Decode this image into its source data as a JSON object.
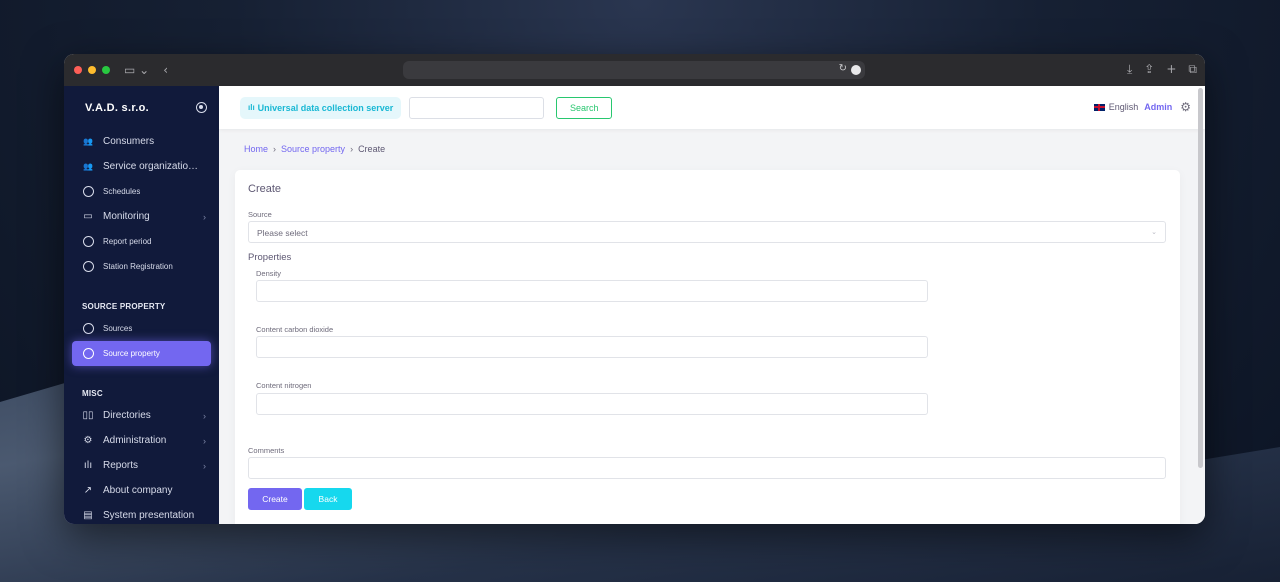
{
  "company": "V.A.D. s.r.o.",
  "sidebar": {
    "items": [
      {
        "label": "Consumers",
        "icon": "users-icon",
        "small": false,
        "chevron": false
      },
      {
        "label": "Service organizatio…",
        "icon": "users-icon",
        "small": false,
        "chevron": false
      },
      {
        "label": "Schedules",
        "icon": "circle-icon",
        "small": true,
        "chevron": false
      },
      {
        "label": "Monitoring",
        "icon": "monitor-icon",
        "small": false,
        "chevron": true
      },
      {
        "label": "Report period",
        "icon": "circle-icon",
        "small": true,
        "chevron": false
      },
      {
        "label": "Station Registration",
        "icon": "circle-icon",
        "small": true,
        "chevron": false
      }
    ],
    "section_source_property": "SOURCE PROPERTY",
    "source_items": [
      {
        "label": "Sources",
        "icon": "circle-icon"
      },
      {
        "label": "Source property",
        "icon": "circle-icon",
        "active": true
      }
    ],
    "section_misc": "MISC",
    "misc_items": [
      {
        "label": "Directories",
        "icon": "book-icon",
        "chevron": true
      },
      {
        "label": "Administration",
        "icon": "settings-icon",
        "chevron": true
      },
      {
        "label": "Reports",
        "icon": "bar-chart-icon",
        "chevron": true
      },
      {
        "label": "About company",
        "icon": "external-link-icon",
        "chevron": false
      },
      {
        "label": "System presentation",
        "icon": "file-icon",
        "chevron": false
      }
    ]
  },
  "topbar": {
    "server_label": "Universal data collection server",
    "search_value": "",
    "search_button": "Search",
    "language": "English",
    "user": "Admin"
  },
  "breadcrumb": {
    "home": "Home",
    "parent": "Source property",
    "current": "Create"
  },
  "form": {
    "title": "Create",
    "source_label": "Source",
    "source_value": "Please select",
    "properties_heading": "Properties",
    "density_label": "Density",
    "density_value": "",
    "co2_label": "Content carbon dioxide",
    "co2_value": "",
    "nitrogen_label": "Content nitrogen",
    "nitrogen_value": "",
    "comments_label": "Comments",
    "comments_value": "",
    "create_button": "Create",
    "back_button": "Back"
  },
  "colors": {
    "sidebar_bg": "#111a3b",
    "accent": "#7367f0",
    "success": "#28c76f",
    "info": "#16d8ee"
  }
}
